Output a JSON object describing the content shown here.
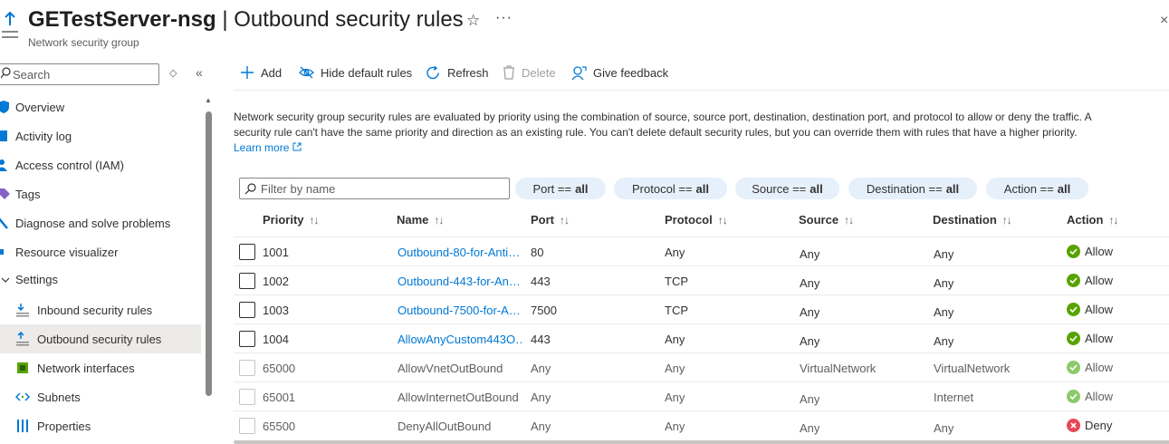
{
  "header": {
    "resource_name": "GETestServer-nsg",
    "separator": "|",
    "page_name": "Outbound security rules",
    "subtitle": "Network security group"
  },
  "sidebar": {
    "search_placeholder": "Search",
    "items": [
      {
        "label": "Overview",
        "icon": "shield-icon"
      },
      {
        "label": "Activity log",
        "icon": "activity-log-icon"
      },
      {
        "label": "Access control (IAM)",
        "icon": "people-icon"
      },
      {
        "label": "Tags",
        "icon": "tag-icon"
      },
      {
        "label": "Diagnose and solve problems",
        "icon": "wrench-icon"
      },
      {
        "label": "Resource visualizer",
        "icon": "visualizer-icon"
      },
      {
        "label": "Settings",
        "icon": "chevron-down-icon"
      },
      {
        "label": "Inbound security rules",
        "icon": "inbound-rules-icon"
      },
      {
        "label": "Outbound security rules",
        "icon": "outbound-rules-icon",
        "active": true
      },
      {
        "label": "Network interfaces",
        "icon": "network-interface-icon"
      },
      {
        "label": "Subnets",
        "icon": "subnet-icon"
      },
      {
        "label": "Properties",
        "icon": "properties-icon"
      }
    ]
  },
  "toolbar": {
    "add": "Add",
    "hide_default": "Hide default rules",
    "refresh": "Refresh",
    "delete": "Delete",
    "feedback": "Give feedback"
  },
  "description": {
    "line1": "Network security group security rules are evaluated by priority using the combination of source, source port, destination, destination port, and protocol to allow or deny the traffic. A",
    "line2": "security rule can't have the same priority and direction as an existing rule. You can't delete default security rules, but you can override them with rules that have a higher priority.",
    "learn_more": "Learn more"
  },
  "filters": {
    "placeholder": "Filter by name",
    "pills": [
      {
        "label": "Port ==",
        "value": "all"
      },
      {
        "label": "Protocol ==",
        "value": "all"
      },
      {
        "label": "Source ==",
        "value": "all"
      },
      {
        "label": "Destination ==",
        "value": "all"
      },
      {
        "label": "Action ==",
        "value": "all"
      }
    ]
  },
  "table": {
    "columns": [
      "Priority",
      "Name",
      "Port",
      "Protocol",
      "Source",
      "Destination",
      "Action"
    ],
    "rows": [
      {
        "priority": "1001",
        "name": "Outbound-80-for-Anti…",
        "port": "80",
        "protocol": "Any",
        "source": "Any",
        "destination": "Any",
        "action": "Allow",
        "default": false
      },
      {
        "priority": "1002",
        "name": "Outbound-443-for-An…",
        "port": "443",
        "protocol": "TCP",
        "source": "Any",
        "destination": "Any",
        "action": "Allow",
        "default": false
      },
      {
        "priority": "1003",
        "name": "Outbound-7500-for-A…",
        "port": "7500",
        "protocol": "TCP",
        "source": "Any",
        "destination": "Any",
        "action": "Allow",
        "default": false
      },
      {
        "priority": "1004",
        "name": "AllowAnyCustom443O…",
        "port": "443",
        "protocol": "Any",
        "source": "Any",
        "destination": "Any",
        "action": "Allow",
        "default": false
      },
      {
        "priority": "65000",
        "name": "AllowVnetOutBound",
        "port": "Any",
        "protocol": "Any",
        "source": "VirtualNetwork",
        "destination": "VirtualNetwork",
        "action": "Allow",
        "default": true
      },
      {
        "priority": "65001",
        "name": "AllowInternetOutBound",
        "port": "Any",
        "protocol": "Any",
        "source": "Any",
        "destination": "Internet",
        "action": "Allow",
        "default": true
      },
      {
        "priority": "65500",
        "name": "DenyAllOutBound",
        "port": "Any",
        "protocol": "Any",
        "source": "Any",
        "destination": "Any",
        "action": "Deny",
        "default": true
      }
    ]
  },
  "colors": {
    "accent": "#0078d4",
    "allow": "#57a300",
    "deny": "#e74856",
    "pill_bg": "#e6f0fb"
  }
}
